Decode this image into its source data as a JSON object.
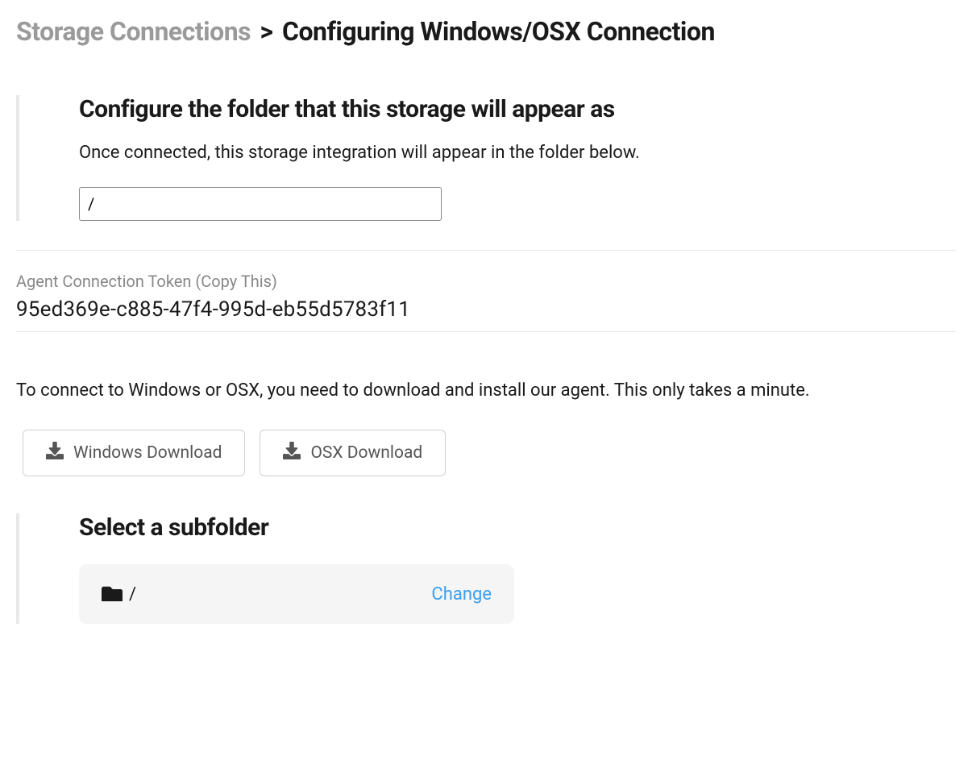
{
  "breadcrumb": {
    "root": "Storage Connections",
    "separator": ">",
    "current": "Configuring Windows/OSX Connection"
  },
  "configure": {
    "heading": "Configure the folder that this storage will appear as",
    "description": "Once connected, this storage integration will appear in the folder below.",
    "folder_value": "/"
  },
  "token": {
    "label": "Agent Connection Token (Copy This)",
    "value": "95ed369e-c885-47f4-995d-eb55d5783f11"
  },
  "agent_info": "To connect to Windows or OSX, you need to download and install our agent. This only takes a minute.",
  "downloads": {
    "windows_label": "Windows Download",
    "osx_label": "OSX Download"
  },
  "subfolder": {
    "heading": "Select a subfolder",
    "path": "/",
    "change_label": "Change"
  }
}
